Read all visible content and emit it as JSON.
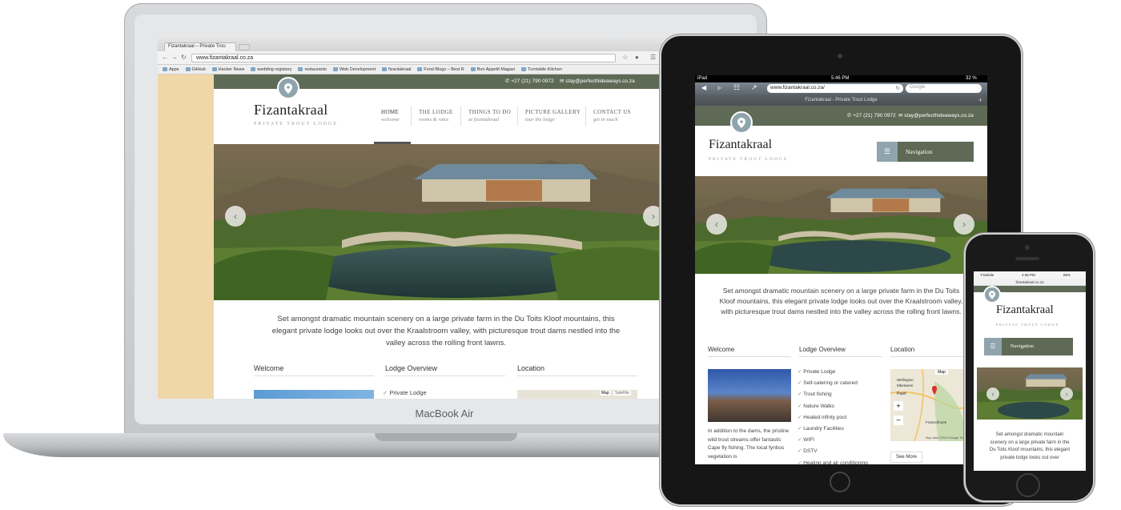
{
  "macbook": {
    "device_label": "MacBook Air",
    "browser": {
      "tab_title": "Fizantakraal – Private Trou",
      "url": "www.fizantakraal.co.za",
      "bookmarks": [
        "Apps",
        "GitHub",
        "Hacker News",
        "wedding registery",
        "restaurants",
        "Web Development",
        "fizantakraal",
        "Food Blogs – Best R",
        "Bon Appetit Magazi",
        "Turntable Kitchen"
      ]
    },
    "site": {
      "phone": "+27 (21) 790 0972",
      "email": "stay@perfecthideaways.co.za",
      "logo_title": "Fizantakraal",
      "logo_subtitle": "PRIVATE TROUT LODGE",
      "menu": [
        {
          "label": "HOME",
          "sub": "welcome"
        },
        {
          "label": "THE LODGE",
          "sub": "rooms & rates"
        },
        {
          "label": "THINGS TO DO",
          "sub": "at fizantakraal"
        },
        {
          "label": "PICTURE GALLERY",
          "sub": "tour the lodge"
        },
        {
          "label": "CONTACT US",
          "sub": "get in touch"
        }
      ],
      "intro": "Set amongst dramatic mountain scenery on a large private farm in the Du Toits Kloof mountains, this elegant private lodge looks out over the Kraalstroom valley, with picturesque trout dams nestled into the valley across the rolling front lawns.",
      "columns": [
        "Welcome",
        "Lodge Overview",
        "Location"
      ],
      "first_feature": "Private Lodge",
      "map_buttons": [
        "Map",
        "Satellite"
      ]
    }
  },
  "ipad": {
    "status": {
      "carrier": "iPad",
      "time": "5:46 PM",
      "battery": "32 %"
    },
    "url": "www.fizantakraal.co.za/",
    "search_placeholder": "Google",
    "page_title": "Fizantakraal - Private Trout Lodge",
    "phone": "+27 (21) 790 0972",
    "email": "stay@perfecthideaways.co.za",
    "logo_title": "Fizantakraal",
    "logo_subtitle": "PRIVATE TROUT LODGE",
    "navigation_label": "Navigation",
    "intro": "Set amongst dramatic mountain scenery on a large private farm in the Du Toits Kloof mountains, this elegant private lodge looks out over the Kraalstroom valley, with picturesque trout dams nestled into the valley across the rolling front lawns.",
    "columns": [
      "Welcome",
      "Lodge Overview",
      "Location"
    ],
    "welcome_text": "In addition to the dams, the pristine wild trout streams offer fantastic Cape fly fishing. The local fynbos vegetation is",
    "features": [
      "Private Lodge",
      "Self-catering or catered",
      "Trout fishing",
      "Nature Walks",
      "Heated infinty pool",
      "Laundry Facilities",
      "WIFI",
      "DSTV",
      "Heating and air conditioning"
    ],
    "map_labels": {
      "map_button": "Map",
      "place1": "Wellington",
      "place2": "Mbekweni",
      "place3": "Paarl",
      "place4": "Franschhoek",
      "footer": "Map data ©2013 Google  Terms of Use"
    },
    "see_more": "See More"
  },
  "iphone": {
    "status": {
      "carrier": "T-Mobile",
      "time": "4:36 PM",
      "battery": "89%"
    },
    "url": "fizantakraal.co.za",
    "logo_title": "Fizantakraal",
    "logo_subtitle": "PRIVATE TROUT LODGE",
    "navigation_label": "Navigation",
    "intro": "Set amongst dramatic mountain scenery on a large private farm in the Du Toits Kloof mountains, this elegant private lodge looks out over"
  },
  "colors": {
    "topbar_green": "#5e6a55",
    "pin_blue": "#8fa4ad",
    "left_band_sand": "#f0d7a8"
  }
}
